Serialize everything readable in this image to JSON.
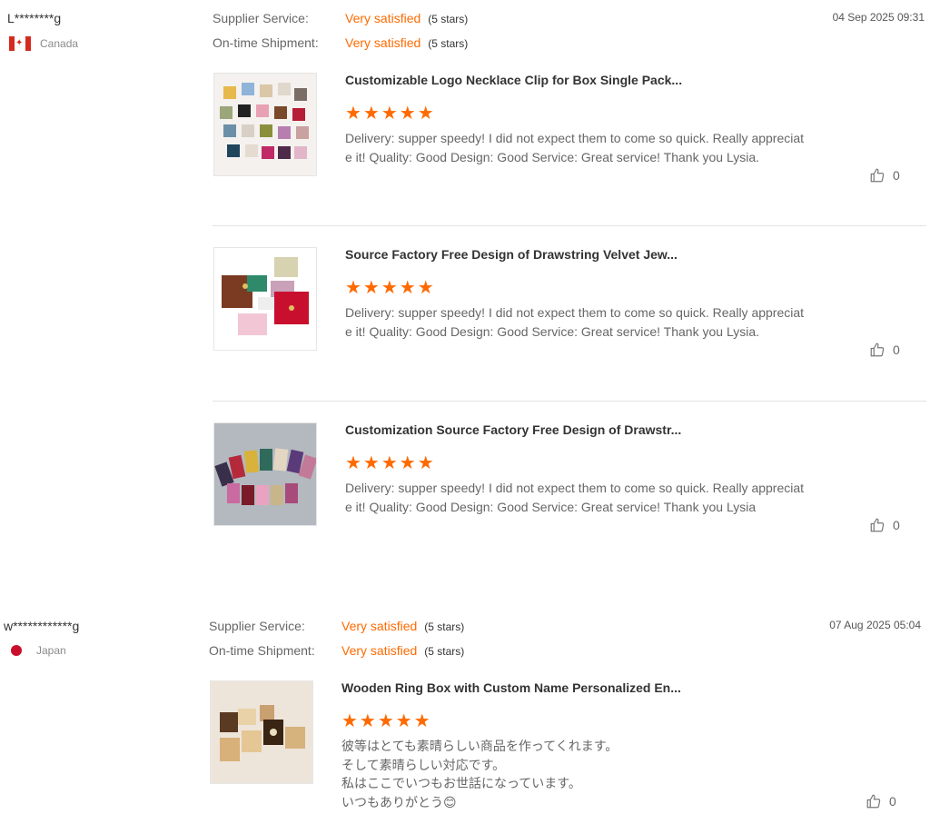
{
  "reviews": [
    {
      "user": "L********g",
      "country": "Canada",
      "supplier_label": "Supplier Service:",
      "supplier_value": "Very satisfied",
      "supplier_count": "(5 stars)",
      "shipment_label": "On-time Shipment:",
      "shipment_value": "Very satisfied",
      "shipment_count": "(5 stars)",
      "date": "04 Sep 2025 09:31",
      "items": [
        {
          "title": "Customizable Logo Necklace Clip for Box Single Pack...",
          "stars": "★★★★★",
          "comment": "Delivery:   supper speedy! I did not expect them to come so quick. Really appreciate it! Quality:   Good Design:   Good Service:   Great service! Thank you Lysia.",
          "likes": "0"
        },
        {
          "title": "Source Factory Free Design of Drawstring Velvet Jew...",
          "stars": "★★★★★",
          "comment": "Delivery:   supper speedy! I did not expect them to come so quick. Really appreciate it! Quality:   Good Design:   Good Service:   Great service! Thank you Lysia.",
          "likes": "0"
        },
        {
          "title": "Customization Source Factory Free Design of Drawstr...",
          "stars": "★★★★★",
          "comment": "Delivery:   supper speedy! I did not expect them to come so quick. Really appreciate it! Quality:   Good Design:   Good Service:   Great service! Thank you Lysia",
          "likes": "0"
        }
      ]
    },
    {
      "user": "w************g",
      "country": "Japan",
      "supplier_label": "Supplier Service:",
      "supplier_value": "Very satisfied",
      "supplier_count": "(5 stars)",
      "shipment_label": "On-time Shipment:",
      "shipment_value": "Very satisfied",
      "shipment_count": "(5 stars)",
      "date": "07 Aug 2025 05:04",
      "items": [
        {
          "title": "Wooden Ring Box with Custom Name Personalized En...",
          "stars": "★★★★★",
          "comment": "彼等はとても素晴らしい商品を作ってくれます。\nそして素晴らしい対応です。\n私はここでいつもお世話になっています。\nいつもありがとう😊",
          "likes": "0"
        }
      ]
    }
  ],
  "colors": {
    "accent": "#ff6a00",
    "separator": "#e3e3e3"
  },
  "icons": {
    "like": "thumbs-up-icon",
    "flag_ca": "canada-flag-icon",
    "flag_jp": "japan-flag-icon"
  }
}
